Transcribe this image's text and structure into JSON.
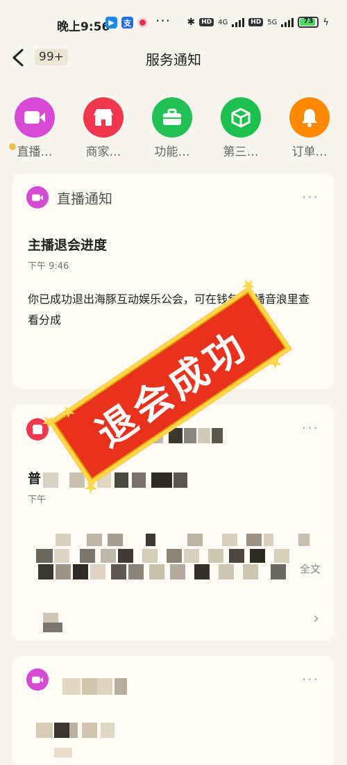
{
  "status_bar": {
    "time": "晚上9:56",
    "app_icons": [
      "dolphin-app-icon",
      "alipay-icon",
      "record-icon"
    ],
    "more": "···",
    "network": [
      "4G",
      "5G"
    ],
    "battery": "73"
  },
  "nav": {
    "back_icon": "chevron-left-icon",
    "unread_count": "99+",
    "title": "服务通知"
  },
  "categories": [
    {
      "label": "直播…",
      "icon": "video-camera-icon",
      "color": "#d74ad3"
    },
    {
      "label": "商家…",
      "icon": "store-icon",
      "color": "#f0374d"
    },
    {
      "label": "功能…",
      "icon": "briefcase-icon",
      "color": "#22c055"
    },
    {
      "label": "第三…",
      "icon": "cube-icon",
      "color": "#1dbf4e"
    },
    {
      "label": "订单…",
      "icon": "bell-icon",
      "color": "#ff8a00"
    }
  ],
  "card1": {
    "source": "直播通知",
    "more": "···",
    "title": "主播退会进度",
    "time": "下午 9:46",
    "body": "你已成功退出海豚互动娱乐公会，可在钱包-直播音浪里查看分成"
  },
  "stamp": {
    "text": "退会成功"
  },
  "card2": {
    "title_prefix": "普",
    "time_prefix": "下午",
    "full_text": "全文",
    "more": "···"
  },
  "card3": {
    "more": "···"
  },
  "colors": {
    "background": "#f7f5ef",
    "card": "#fdfbf5",
    "stamp_red": "#e8321d",
    "stamp_gold": "#ffd54a"
  }
}
